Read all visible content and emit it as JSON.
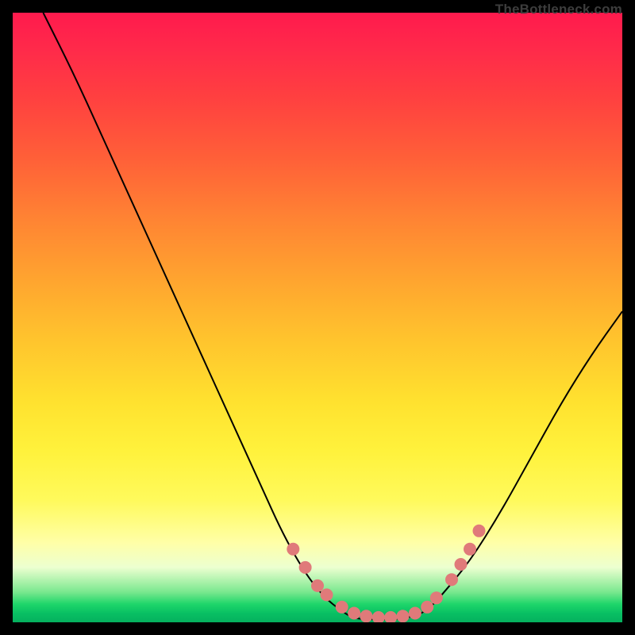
{
  "watermark": "TheBottleneck.com",
  "chart_data": {
    "type": "line",
    "title": "",
    "xlabel": "",
    "ylabel": "",
    "xlim": [
      0,
      100
    ],
    "ylim": [
      0,
      100
    ],
    "grid": false,
    "legend": false,
    "series": [
      {
        "name": "bottleneck-curve",
        "x": [
          5,
          10,
          15,
          20,
          25,
          30,
          35,
          40,
          45,
          50,
          55,
          57,
          60,
          63,
          66,
          68,
          70,
          75,
          80,
          85,
          90,
          95,
          100
        ],
        "y": [
          100,
          90,
          79,
          68,
          57,
          46,
          35,
          24,
          13,
          5,
          1,
          0.5,
          0.5,
          0.5,
          1,
          2,
          4,
          10,
          18,
          27,
          36,
          44,
          51
        ]
      }
    ],
    "highlight_points": {
      "name": "highlighted-dots",
      "x": [
        46,
        48,
        50,
        51.5,
        54,
        56,
        58,
        60,
        62,
        64,
        66,
        68,
        69.5,
        72,
        73.5,
        75,
        76.5
      ],
      "y": [
        12,
        9,
        6,
        4.5,
        2.5,
        1.5,
        1,
        0.8,
        0.8,
        1,
        1.5,
        2.5,
        4,
        7,
        9.5,
        12,
        15
      ]
    },
    "background_gradient": {
      "top": "#ff1a4d",
      "mid_upper": "#ff8433",
      "mid": "#ffe22f",
      "mid_lower": "#ffffa8",
      "bottom": "#05b05e"
    }
  }
}
